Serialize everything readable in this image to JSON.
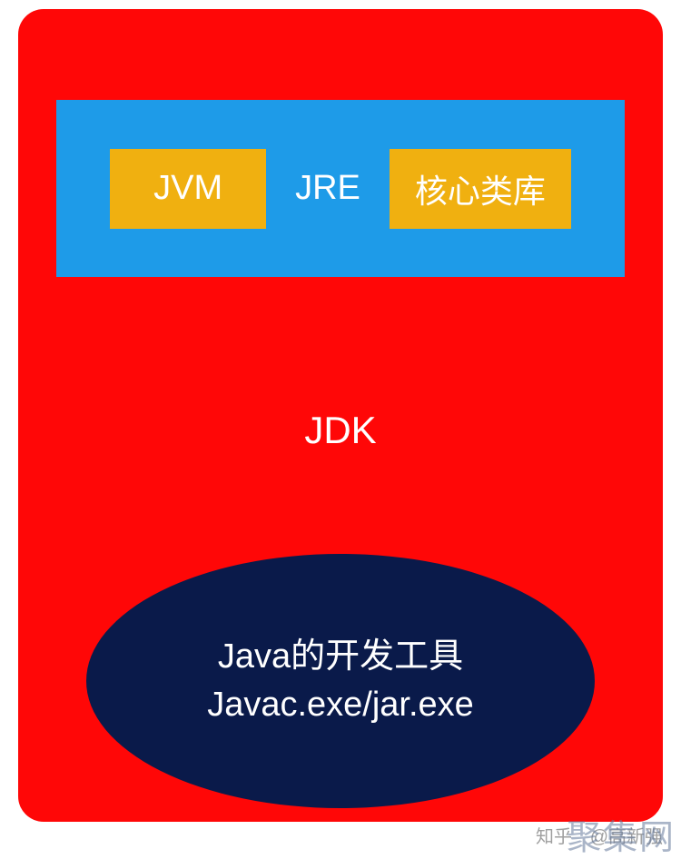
{
  "diagram": {
    "jre": {
      "jvm_label": "JVM",
      "jre_label": "JRE",
      "core_lib_label": "核心类库"
    },
    "jdk_label": "JDK",
    "tools": {
      "line1": "Java的开发工具",
      "line2": "Javac.exe/jar.exe"
    }
  },
  "watermark": {
    "zhihu": "知乎",
    "author": "@高新强",
    "site": "聚集网"
  }
}
